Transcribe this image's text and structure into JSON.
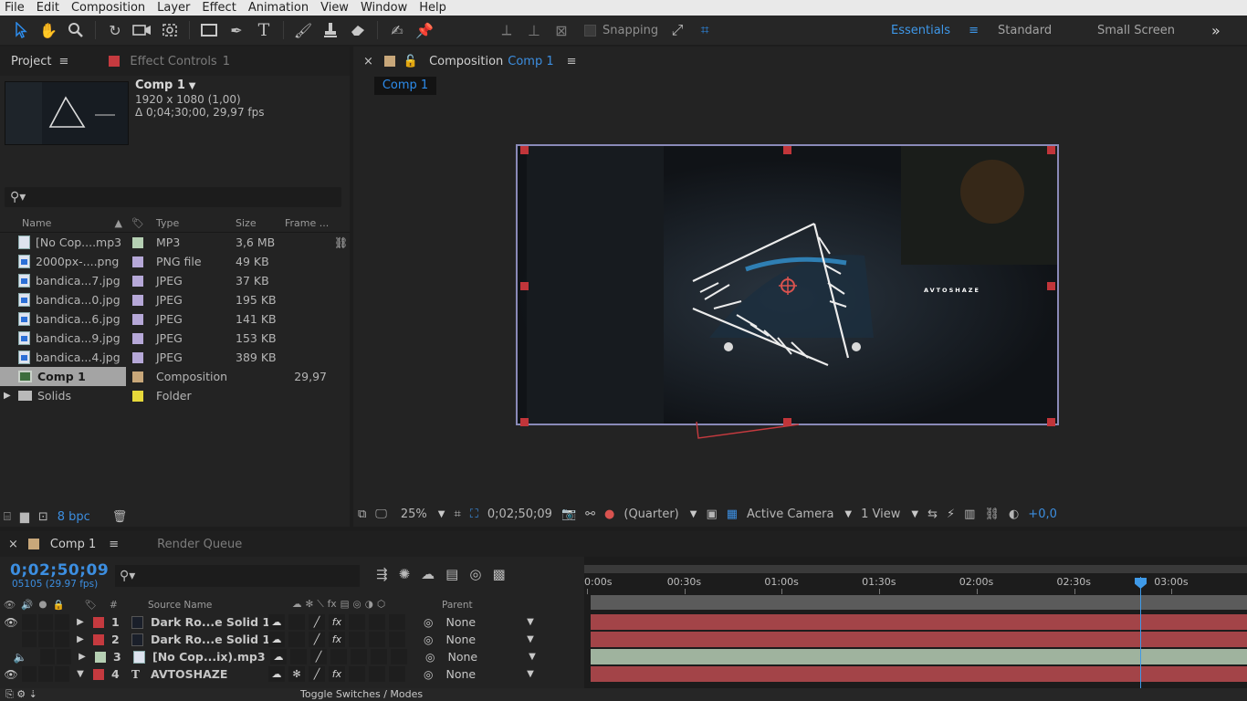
{
  "menu": [
    "File",
    "Edit",
    "Composition",
    "Layer",
    "Effect",
    "Animation",
    "View",
    "Window",
    "Help"
  ],
  "toolbar": {
    "snapping_label": "Snapping",
    "workspaces": [
      "Essentials",
      "Standard",
      "Small Screen"
    ],
    "active_workspace": "Essentials",
    "overflow": "»"
  },
  "project_panel": {
    "tab_project": "Project",
    "tab_effect_controls": "Effect Controls",
    "effect_controls_target": "1",
    "comp_name": "Comp 1",
    "comp_resolution": "1920 x 1080 (1,00)",
    "comp_duration": "Δ 0;04;30;00, 29,97 fps",
    "columns": [
      "Name",
      "Type",
      "Size",
      "Frame ..."
    ],
    "items": [
      {
        "name": "[No Cop....mp3",
        "type": "MP3",
        "size": "3,6 MB",
        "frame": "",
        "label_color": "#b5cfb3",
        "icon": "audio"
      },
      {
        "name": "2000px-....png",
        "type": "PNG file",
        "size": "49 KB",
        "frame": "",
        "label_color": "#b6a8d8",
        "icon": "image"
      },
      {
        "name": "bandica...7.jpg",
        "type": "JPEG",
        "size": "37 KB",
        "frame": "",
        "label_color": "#b6a8d8",
        "icon": "image"
      },
      {
        "name": "bandica...0.jpg",
        "type": "JPEG",
        "size": "195 KB",
        "frame": "",
        "label_color": "#b6a8d8",
        "icon": "image"
      },
      {
        "name": "bandica...6.jpg",
        "type": "JPEG",
        "size": "141 KB",
        "frame": "",
        "label_color": "#b6a8d8",
        "icon": "image"
      },
      {
        "name": "bandica...9.jpg",
        "type": "JPEG",
        "size": "153 KB",
        "frame": "",
        "label_color": "#b6a8d8",
        "icon": "image"
      },
      {
        "name": "bandica...4.jpg",
        "type": "JPEG",
        "size": "389 KB",
        "frame": "",
        "label_color": "#b6a8d8",
        "icon": "image"
      },
      {
        "name": "Comp 1",
        "type": "Composition",
        "size": "",
        "frame": "29,97",
        "label_color": "#c8a77a",
        "icon": "comp"
      },
      {
        "name": "Solids",
        "type": "Folder",
        "size": "",
        "frame": "",
        "label_color": "#e6d83a",
        "icon": "folder"
      }
    ],
    "bpc": "8 bpc"
  },
  "comp_viewer": {
    "tab_prefix": "Composition",
    "tab_comp": "Comp 1",
    "sub_tab": "Comp 1",
    "overlay_text": "AVTOSHAZE",
    "zoom": "25%",
    "timecode": "0;02;50;09",
    "resolution": "(Quarter)",
    "camera": "Active Camera",
    "views": "1 View",
    "exposure": "+0,0"
  },
  "timeline": {
    "tab_comp": "Comp 1",
    "tab_render": "Render Queue",
    "timecode": "0;02;50;09",
    "frames": "05105 (29.97 fps)",
    "columns": {
      "num": "#",
      "source": "Source Name",
      "parent": "Parent"
    },
    "ruler": [
      "0:00s",
      "00:30s",
      "01:00s",
      "01:30s",
      "02:00s",
      "02:30s",
      "03:00s"
    ],
    "layers": [
      {
        "num": "1",
        "name": "Dark Ro...e Solid 1",
        "parent": "None",
        "color": "#c53a3f",
        "bar_color": "#a34448",
        "type": "solid",
        "video": true,
        "audio": false,
        "fx": true
      },
      {
        "num": "2",
        "name": "Dark Ro...e Solid 1",
        "parent": "None",
        "color": "#c53a3f",
        "bar_color": "#a34448",
        "type": "solid",
        "video": false,
        "audio": false,
        "fx": true
      },
      {
        "num": "3",
        "name": "[No Cop...ix).mp3",
        "parent": "None",
        "color": "#b5cfb3",
        "bar_color": "#9fb39e",
        "type": "audio",
        "video": false,
        "audio": true,
        "fx": false
      },
      {
        "num": "4",
        "name": "AVTOSHAZE",
        "parent": "None",
        "color": "#c53a3f",
        "bar_color": "#a34448",
        "type": "text",
        "video": true,
        "audio": false,
        "fx": true
      }
    ],
    "toggle_label": "Toggle Switches / Modes"
  }
}
